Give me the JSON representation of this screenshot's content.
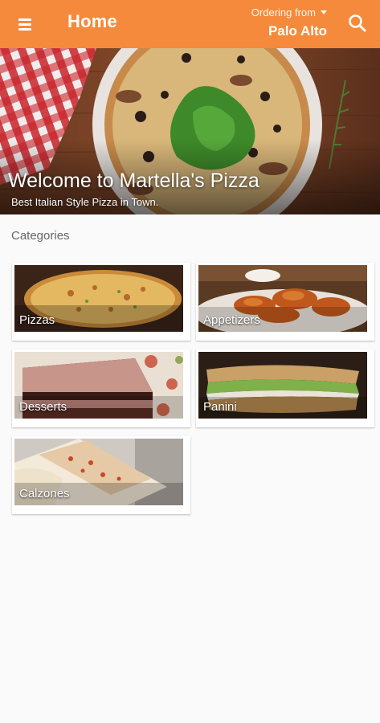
{
  "app_bar": {
    "title": "Home",
    "ordering_label": "Ordering from",
    "ordering_city": "Palo Alto",
    "menu_icon": "hamburger-menu-icon",
    "search_icon": "search-icon",
    "background_color": "#f58a3c"
  },
  "hero": {
    "title": "Welcome to Martella's Pizza",
    "subtitle": "Best Italian Style Pizza in Town."
  },
  "categories": {
    "heading": "Categories",
    "items": [
      {
        "label": "Pizzas"
      },
      {
        "label": "Appetizers"
      },
      {
        "label": "Desserts"
      },
      {
        "label": "Panini"
      },
      {
        "label": "Calzones"
      }
    ]
  }
}
